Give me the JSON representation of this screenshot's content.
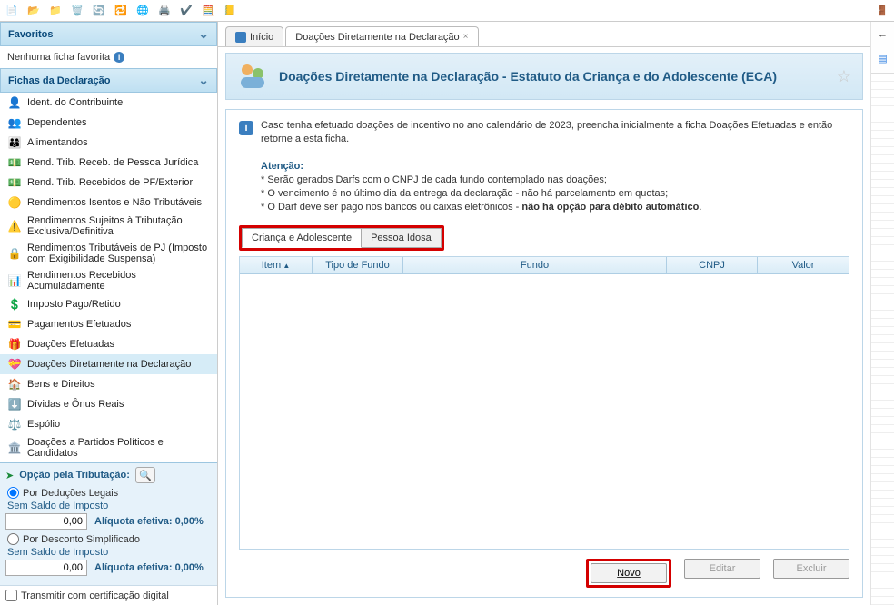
{
  "toolbar": {
    "exit_tooltip": "Sair"
  },
  "sidebar": {
    "favorites": {
      "title": "Favoritos",
      "empty": "Nenhuma ficha favorita"
    },
    "fichas_title": "Fichas da Declaração",
    "fichas": [
      "Ident. do Contribuinte",
      "Dependentes",
      "Alimentandos",
      "Rend. Trib. Receb. de Pessoa Jurídica",
      "Rend. Trib. Recebidos de PF/Exterior",
      "Rendimentos Isentos e Não Tributáveis",
      "Rendimentos Sujeitos à Tributação Exclusiva/Definitiva",
      "Rendimentos Tributáveis de PJ (Imposto com Exigibilidade Suspensa)",
      "Rendimentos Recebidos Acumuladamente",
      "Imposto Pago/Retido",
      "Pagamentos Efetuados",
      "Doações Efetuadas",
      "Doações Diretamente na Declaração",
      "Bens e Direitos",
      "Dívidas e Ônus Reais",
      "Espólio",
      "Doações a Partidos Políticos e Candidatos"
    ],
    "summary": {
      "title": "Opção pela Tributação:",
      "opt_deducoes": "Por Deduções Legais",
      "opt_simplificado": "Por Desconto Simplificado",
      "sem_saldo": "Sem Saldo de Imposto",
      "value": "0,00",
      "aliquota": "Alíquota efetiva: 0,00%",
      "cert_digital": "Transmitir com certificação digital"
    }
  },
  "tabs": {
    "home": "Início",
    "active": "Doações Diretamente na Declaração"
  },
  "page": {
    "title": "Doações Diretamente na Declaração - Estatuto da Criança e do Adolescente (ECA)",
    "notice_msg": "Caso tenha efetuado doações de incentivo no ano calendário de 2023, preencha inicialmente a ficha Doações Efetuadas e então retorne a esta ficha.",
    "atencao": "Atenção:",
    "l1": "* Serão gerados Darfs com o CNPJ de cada fundo contemplado nas doações;",
    "l2": "* O vencimento é no último dia da entrega da declaração - não há parcelamento em quotas;",
    "l3a": "* O Darf deve ser pago nos bancos ou caixas eletrônicos - ",
    "l3b": "não há opção para débito automático",
    "l3c": ".",
    "subtab_crianca": "Criança e Adolescente",
    "subtab_idosa": "Pessoa Idosa",
    "cols": {
      "item": "Item",
      "tipo": "Tipo de Fundo",
      "fundo": "Fundo",
      "cnpj": "CNPJ",
      "valor": "Valor"
    },
    "btn_novo": "Novo",
    "btn_editar": "Editar",
    "btn_excluir": "Excluir"
  }
}
